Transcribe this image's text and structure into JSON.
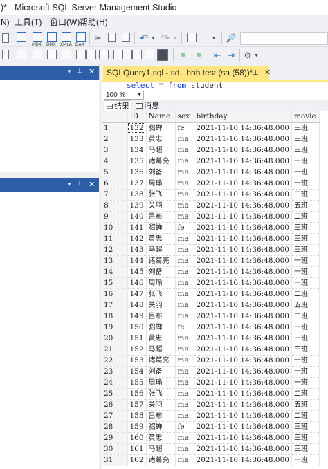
{
  "window": {
    "title": ")* - Microsoft SQL Server Management Studio"
  },
  "menu": {
    "items": [
      "N)",
      "工具(T)",
      "窗口(W)",
      "帮助(H)"
    ]
  },
  "toolbar": {
    "icon_labels": [
      "MDX",
      "DMX",
      "XMLA",
      "DAX"
    ],
    "undo_icon": "undo-icon",
    "redo_icon": "redo-icon",
    "search_value": ""
  },
  "panels": {
    "top": {
      "pin": "📌",
      "dropdown": "▼",
      "close": "✕"
    },
    "bottom": {
      "pin": "📌",
      "dropdown": "▼",
      "close": "✕"
    }
  },
  "document": {
    "tab_title": "SQLQuery1.sql - sd...hhh.test (sa (58))*",
    "tab_pin": "📌",
    "tab_close": "✕",
    "sql_select": "select",
    "sql_star": "*",
    "sql_from": "from",
    "sql_table": "student",
    "zoom": "100 %"
  },
  "results": {
    "tabs": [
      {
        "label": "结果",
        "active": true
      },
      {
        "label": "消息",
        "active": false
      }
    ],
    "columns": [
      "",
      "ID",
      "Name",
      "sex",
      "birthday",
      "movie"
    ],
    "rows": [
      [
        "1",
        "132",
        "貂蝉",
        "fe",
        "2021-11-10 14:36:48.000",
        "三班"
      ],
      [
        "2",
        "133",
        "黄忠",
        "ma",
        "2021-11-10 14:36:48.000",
        "三班"
      ],
      [
        "3",
        "134",
        "马超",
        "ma",
        "2021-11-10 14:36:48.000",
        "三班"
      ],
      [
        "4",
        "135",
        "诸葛亮",
        "ma",
        "2021-11-10 14:36:48.000",
        "一班"
      ],
      [
        "5",
        "136",
        "刘备",
        "ma",
        "2021-11-10 14:36:48.000",
        "一班"
      ],
      [
        "6",
        "137",
        "周瑜",
        "ma",
        "2021-11-10 14:36:48.000",
        "一班"
      ],
      [
        "7",
        "138",
        "张飞",
        "ma",
        "2021-11-10 14:36:48.000",
        "二班"
      ],
      [
        "8",
        "139",
        "关羽",
        "ma",
        "2021-11-10 14:36:48.000",
        "五班"
      ],
      [
        "9",
        "140",
        "吕布",
        "ma",
        "2021-11-10 14:36:48.000",
        "二班"
      ],
      [
        "10",
        "141",
        "貂蝉",
        "fe",
        "2021-11-10 14:36:48.000",
        "三班"
      ],
      [
        "11",
        "142",
        "黄忠",
        "ma",
        "2021-11-10 14:36:48.000",
        "三班"
      ],
      [
        "12",
        "143",
        "马超",
        "ma",
        "2021-11-10 14:36:48.000",
        "三班"
      ],
      [
        "13",
        "144",
        "诸葛亮",
        "ma",
        "2021-11-10 14:36:48.000",
        "一班"
      ],
      [
        "14",
        "145",
        "刘备",
        "ma",
        "2021-11-10 14:36:48.000",
        "一班"
      ],
      [
        "15",
        "146",
        "周瑜",
        "ma",
        "2021-11-10 14:36:48.000",
        "一班"
      ],
      [
        "16",
        "147",
        "张飞",
        "ma",
        "2021-11-10 14:36:48.000",
        "二班"
      ],
      [
        "17",
        "148",
        "关羽",
        "ma",
        "2021-11-10 14:36:48.000",
        "五班"
      ],
      [
        "18",
        "149",
        "吕布",
        "ma",
        "2021-11-10 14:36:48.000",
        "二班"
      ],
      [
        "19",
        "150",
        "貂蝉",
        "fe",
        "2021-11-10 14:36:48.000",
        "三班"
      ],
      [
        "20",
        "151",
        "黄忠",
        "ma",
        "2021-11-10 14:36:48.000",
        "三班"
      ],
      [
        "21",
        "152",
        "马超",
        "ma",
        "2021-11-10 14:36:48.000",
        "三班"
      ],
      [
        "22",
        "153",
        "诸葛亮",
        "ma",
        "2021-11-10 14:36:48.000",
        "一班"
      ],
      [
        "23",
        "154",
        "刘备",
        "ma",
        "2021-11-10 14:36:48.000",
        "一班"
      ],
      [
        "24",
        "155",
        "周瑜",
        "ma",
        "2021-11-10 14:36:48.000",
        "一班"
      ],
      [
        "25",
        "156",
        "张飞",
        "ma",
        "2021-11-10 14:36:48.000",
        "二班"
      ],
      [
        "26",
        "157",
        "关羽",
        "ma",
        "2021-11-10 14:36:48.000",
        "五班"
      ],
      [
        "27",
        "158",
        "吕布",
        "ma",
        "2021-11-10 14:36:48.000",
        "二班"
      ],
      [
        "28",
        "159",
        "貂蝉",
        "fe",
        "2021-11-10 14:36:48.000",
        "三班"
      ],
      [
        "29",
        "160",
        "黄忠",
        "ma",
        "2021-11-10 14:36:48.000",
        "三班"
      ],
      [
        "30",
        "161",
        "马超",
        "ma",
        "2021-11-10 14:36:48.000",
        "三班"
      ],
      [
        "31",
        "162",
        "诸葛亮",
        "ma",
        "2021-11-10 14:36:48.000",
        "一班"
      ]
    ]
  }
}
